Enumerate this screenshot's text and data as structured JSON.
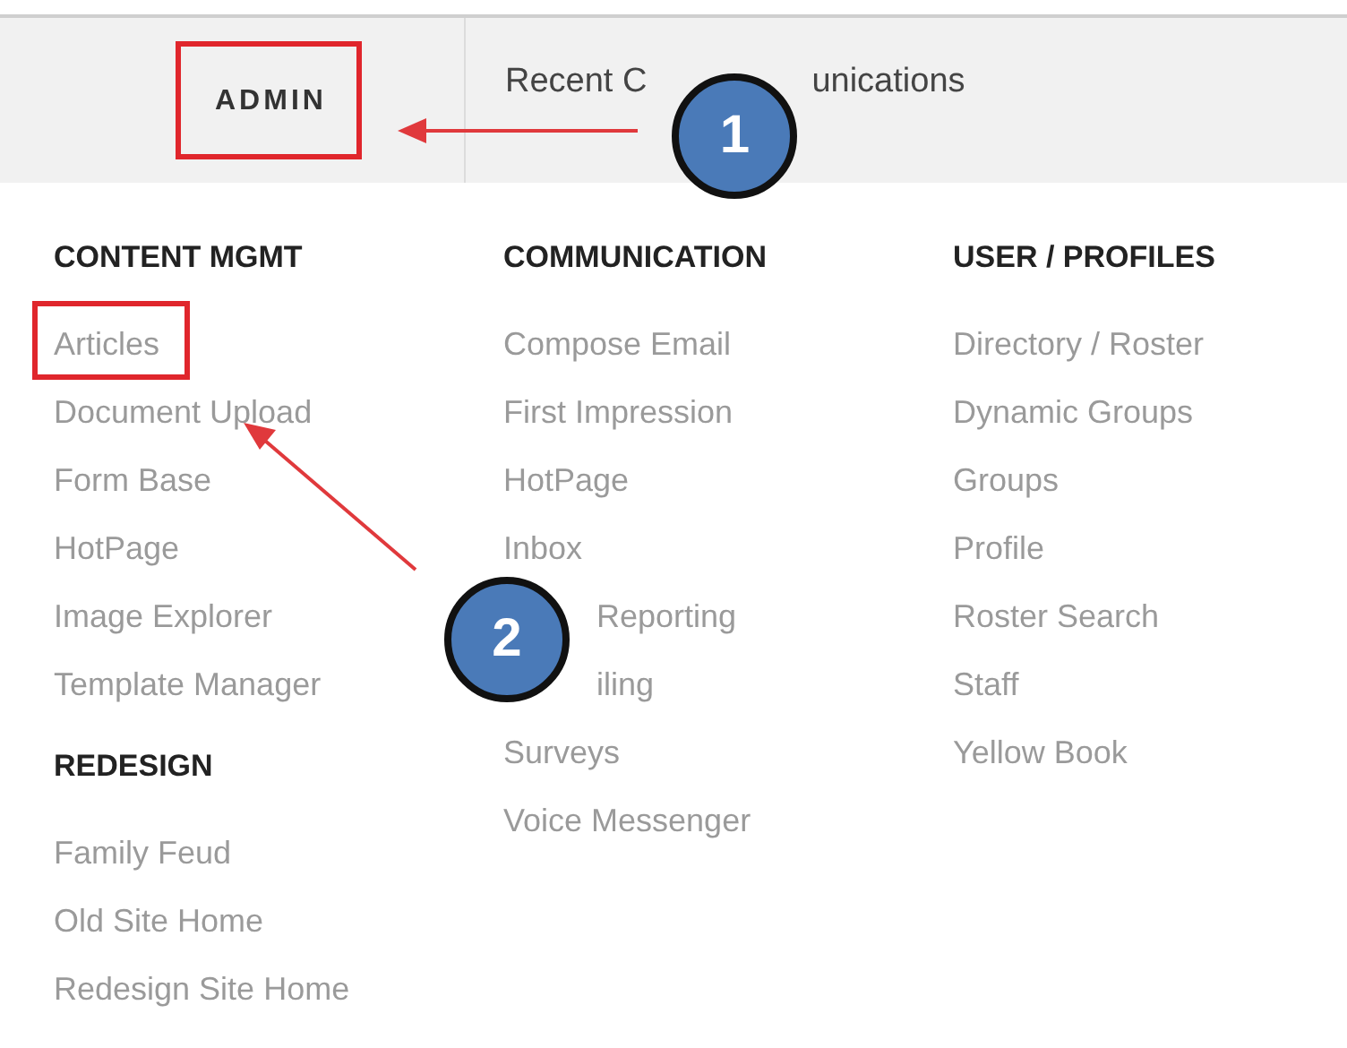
{
  "nav": {
    "admin": {
      "label": "ADMIN",
      "highlighted": true
    },
    "recent_parts": [
      "Recent C",
      "unications"
    ]
  },
  "annotations": [
    {
      "label": "1"
    },
    {
      "label": "2"
    }
  ],
  "columns": [
    {
      "sections": [
        {
          "heading": "CONTENT MGMT",
          "items": [
            {
              "label": "Articles",
              "highlighted": true,
              "kind": "plain"
            },
            {
              "label": "Document Upload",
              "highlighted": false,
              "kind": "plain"
            },
            {
              "label": "Form Base",
              "highlighted": false,
              "kind": "plain"
            },
            {
              "label": "HotPage",
              "highlighted": false,
              "kind": "plain"
            },
            {
              "label": "Image Explorer",
              "highlighted": false,
              "kind": "plain"
            },
            {
              "label": "Template Manager",
              "highlighted": false,
              "kind": "plain"
            }
          ]
        },
        {
          "heading": "REDESIGN",
          "items": [
            {
              "label": "Family Feud",
              "highlighted": false,
              "kind": "plain"
            },
            {
              "label": "Old Site Home",
              "highlighted": false,
              "kind": "plain"
            },
            {
              "label": "Redesign Site Home",
              "highlighted": false,
              "kind": "plain"
            }
          ]
        }
      ]
    },
    {
      "sections": [
        {
          "heading": "COMMUNICATION",
          "items": [
            {
              "label": "Compose Email",
              "highlighted": false,
              "kind": "plain"
            },
            {
              "label": "First Impression",
              "highlighted": false,
              "kind": "plain"
            },
            {
              "label": "HotPage",
              "highlighted": false,
              "kind": "plain"
            },
            {
              "label": "Inbox",
              "highlighted": false,
              "kind": "plain"
            },
            {
              "label": "Reporting",
              "highlighted": false,
              "kind": "covered"
            },
            {
              "label": "iling",
              "highlighted": false,
              "kind": "covered"
            },
            {
              "label": "Surveys",
              "highlighted": false,
              "kind": "plain"
            },
            {
              "label": "Voice Messenger",
              "highlighted": false,
              "kind": "plain"
            }
          ]
        }
      ]
    },
    {
      "sections": [
        {
          "heading": "USER / PROFILES",
          "items": [
            {
              "label": "Directory / Roster",
              "highlighted": false,
              "kind": "plain"
            },
            {
              "label": "Dynamic Groups",
              "highlighted": false,
              "kind": "plain"
            },
            {
              "label": "Groups",
              "highlighted": false,
              "kind": "plain"
            },
            {
              "label": "Profile",
              "highlighted": false,
              "kind": "plain"
            },
            {
              "label": "Roster Search",
              "highlighted": false,
              "kind": "plain"
            },
            {
              "label": "Staff",
              "highlighted": false,
              "kind": "plain"
            },
            {
              "label": "Yellow Book",
              "highlighted": false,
              "kind": "plain"
            }
          ]
        }
      ]
    }
  ]
}
